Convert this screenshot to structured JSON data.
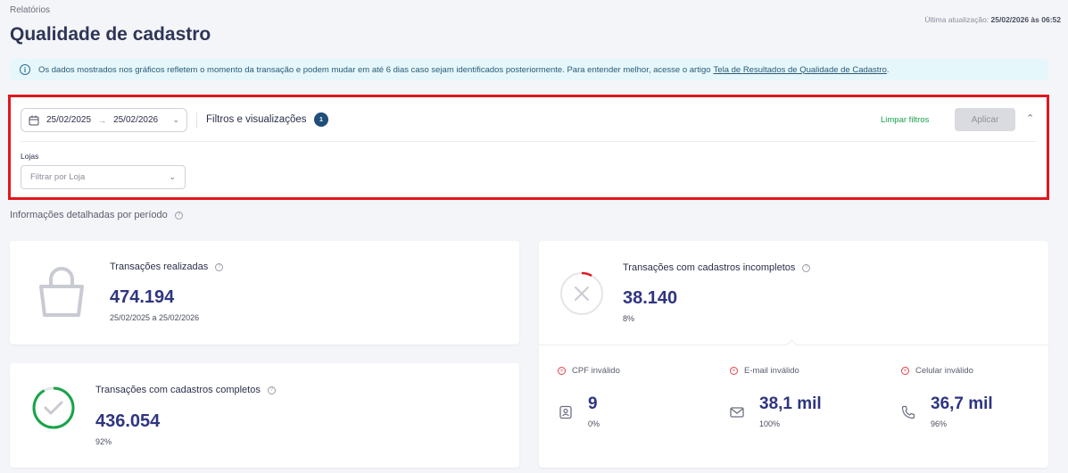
{
  "header": {
    "breadcrumb": "Relatórios",
    "title": "Qualidade de cadastro",
    "last_update_label": "Última atualização:",
    "last_update_value": "25/02/2026 às 06:52"
  },
  "banner": {
    "text": "Os dados mostrados nos gráficos refletem o momento da transação e podem mudar em até 6 dias caso sejam identificados posteriormente. Para entender melhor, acesse o artigo",
    "link": "Tela de Resultados de Qualidade de Cadastro",
    "end": "."
  },
  "filters": {
    "date_start": "25/02/2025",
    "date_end": "25/02/2026",
    "title": "Filtros e visualizações",
    "badge_count": "1",
    "clear_label": "Limpar filtros",
    "apply_label": "Aplicar",
    "store_label": "Lojas",
    "store_placeholder": "Filtrar por Loja"
  },
  "section": {
    "title": "Informações detalhadas por período"
  },
  "cards": {
    "transactions": {
      "title": "Transações realizadas",
      "value": "474.194",
      "period": "25/02/2025 a 25/02/2026"
    },
    "complete": {
      "title": "Transações com cadastros completos",
      "value": "436.054",
      "percent": "92%",
      "fraction": 0.92
    },
    "incomplete": {
      "title": "Transações com cadastros incompletos",
      "value": "38.140",
      "percent": "8%",
      "fraction": 0.08,
      "metrics": [
        {
          "label": "CPF inválido",
          "value": "9",
          "percent": "0%",
          "icon": "id-card-icon"
        },
        {
          "label": "E-mail inválido",
          "value": "38,1 mil",
          "percent": "100%",
          "icon": "mail-icon"
        },
        {
          "label": "Celular inválido",
          "value": "36,7 mil",
          "percent": "96%",
          "icon": "phone-icon"
        }
      ]
    }
  },
  "colors": {
    "accent": "#2f3580",
    "success": "#1aa34a",
    "error": "#e0414b",
    "highlight": "#e0171d"
  }
}
